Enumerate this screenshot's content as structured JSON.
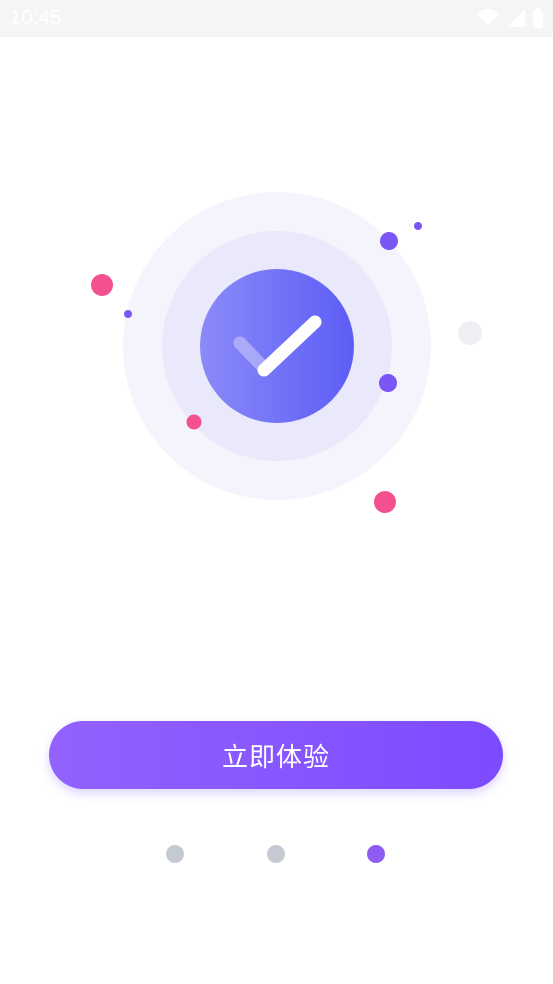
{
  "status_bar": {
    "time": "10:45",
    "icons": [
      "wifi-icon",
      "cellular-signal-icon",
      "battery-icon"
    ]
  },
  "illustration": {
    "icon": "checkmark-icon",
    "colors": {
      "outer_ring": "#f4f4fc",
      "inner_ring": "#e9e9fb",
      "disc_start": "#8a8af8",
      "disc_end": "#5d5df7",
      "pink_dot": "#f44f8f",
      "purple_dot": "#7a56f5",
      "gray_dot": "#eeeff3"
    }
  },
  "cta": {
    "label": "立即体验"
  },
  "pager": {
    "total": 3,
    "active_index": 2,
    "colors": {
      "inactive": "#c5cad2",
      "active": "#8c5cf5"
    }
  }
}
